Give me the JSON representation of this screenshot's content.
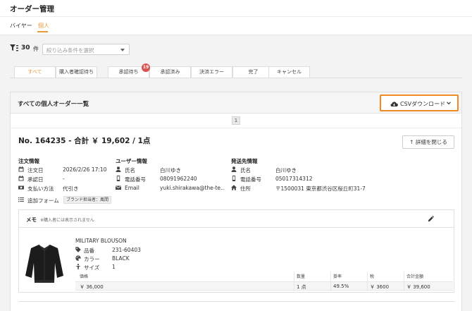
{
  "page": {
    "title": "オーダー管理"
  },
  "sub_tabs": [
    {
      "label": "バイヤー"
    },
    {
      "label": "個人"
    }
  ],
  "filter": {
    "count": "30",
    "count_unit": "件",
    "placeholder": "絞り込み条件を選択"
  },
  "status_tabs": [
    {
      "label": "すべて"
    },
    {
      "label": "購入者確認待ち"
    },
    {
      "label": "承認待ち"
    },
    {
      "label": "承認済み"
    },
    {
      "label": "決済エラー"
    },
    {
      "label": "完了"
    },
    {
      "label": "キャンセル"
    }
  ],
  "pending_badge": "19",
  "card": {
    "title": "すべての個人オーダー一覧",
    "csv_button": "CSVダウンロード",
    "page_number": "1"
  },
  "order": {
    "header": "No. 164235 - 合計 ￥ 19,602 / 1点",
    "close_button": "↑ 詳細を閉じる",
    "order_info": {
      "title": "注文情報",
      "rows": [
        {
          "label": "注文日",
          "value": "2026/2/26 17:10"
        },
        {
          "label": "承認日",
          "value": "-"
        },
        {
          "label": "支払い方法",
          "value": "代引き"
        }
      ]
    },
    "user_info": {
      "title": "ユーザー情報",
      "rows": [
        {
          "label": "氏名",
          "value": "白川ゆき"
        },
        {
          "label": "電話番号",
          "value": "08091962240"
        },
        {
          "label": "Email",
          "value": "yuki.shirakawa@the-te…"
        }
      ]
    },
    "ship_info": {
      "title": "発送先情報",
      "rows": [
        {
          "label": "氏名",
          "value": "白川ゆき"
        },
        {
          "label": "電話番号",
          "value": "05017314312"
        },
        {
          "label": "住所",
          "value": "〒1500031 東京都渋谷区桜丘町31-7"
        }
      ]
    },
    "extra_form": {
      "label": "追加フォーム",
      "chip": "ブランド担当者：風間"
    },
    "memo": {
      "title": "メモ",
      "note": "※購入者には表示されません"
    },
    "item": {
      "name": "MILITARY BLOUSON",
      "attrs": [
        {
          "label": "品番",
          "value": "231-60403"
        },
        {
          "label": "カラー",
          "value": "BLACK"
        },
        {
          "label": "サイズ",
          "value": "1"
        }
      ],
      "table": {
        "headers": [
          "価格",
          "数量",
          "掛率",
          "税",
          "合計金額"
        ],
        "row": [
          "￥ 36,000",
          "1 点",
          "49.5%",
          "￥ 3600",
          "￥ 39,600"
        ]
      }
    }
  }
}
